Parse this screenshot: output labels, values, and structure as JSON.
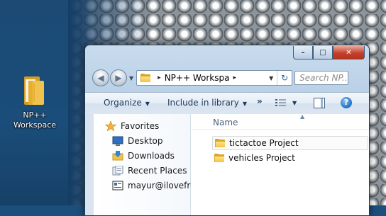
{
  "desktop": {
    "icon_label": "NP++\nWorkspace",
    "icon_line1": "NP++",
    "icon_line2": "Workspace"
  },
  "window": {
    "caption_buttons": {
      "minimize": "–",
      "maximize": "□",
      "close": "✕"
    },
    "address": {
      "crumb": "NP++ Workspa",
      "separator": "▸"
    },
    "search": {
      "placeholder": "Search NP..."
    },
    "toolbar": {
      "organize": "Organize",
      "include_in_library": "Include in library",
      "more": "»"
    },
    "navigation": {
      "favorites": "Favorites",
      "items": [
        {
          "label": "Desktop",
          "icon": "desktop-icon"
        },
        {
          "label": "Downloads",
          "icon": "downloads-icon"
        },
        {
          "label": "Recent Places",
          "icon": "recent-places-icon"
        },
        {
          "label": "mayur@ilovefre",
          "icon": "contact-card-icon"
        }
      ]
    },
    "file_list": {
      "column": "Name",
      "items": [
        {
          "name": "tictactoe Project",
          "selected": true
        },
        {
          "name": "vehicles Project",
          "selected": false
        }
      ]
    }
  },
  "colors": {
    "folder": "#f4c242",
    "close_button": "#c5412c",
    "desktop_background": "#1c4a75"
  }
}
